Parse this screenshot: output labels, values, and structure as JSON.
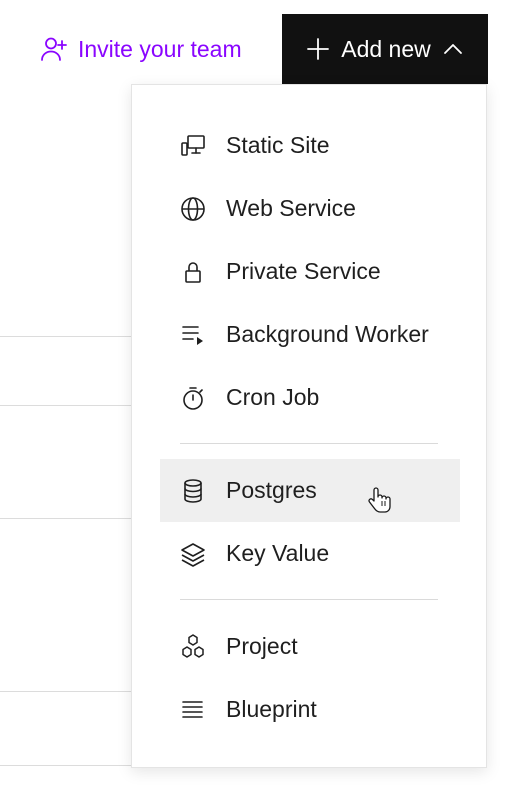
{
  "header": {
    "invite_label": "Invite your team",
    "add_new_label": "Add new"
  },
  "menu": {
    "items": [
      {
        "label": "Static Site",
        "icon": "static-site-icon"
      },
      {
        "label": "Web Service",
        "icon": "globe-icon"
      },
      {
        "label": "Private Service",
        "icon": "lock-icon"
      },
      {
        "label": "Background Worker",
        "icon": "background-worker-icon"
      },
      {
        "label": "Cron Job",
        "icon": "stopwatch-icon"
      },
      {
        "label": "Postgres",
        "icon": "database-icon",
        "hovered": true
      },
      {
        "label": "Key Value",
        "icon": "layers-icon"
      },
      {
        "label": "Project",
        "icon": "hexagons-icon"
      },
      {
        "label": "Blueprint",
        "icon": "list-lines-icon"
      }
    ]
  },
  "colors": {
    "accent": "#8a05ff",
    "button_bg": "#111111",
    "hover_bg": "#efefef"
  }
}
